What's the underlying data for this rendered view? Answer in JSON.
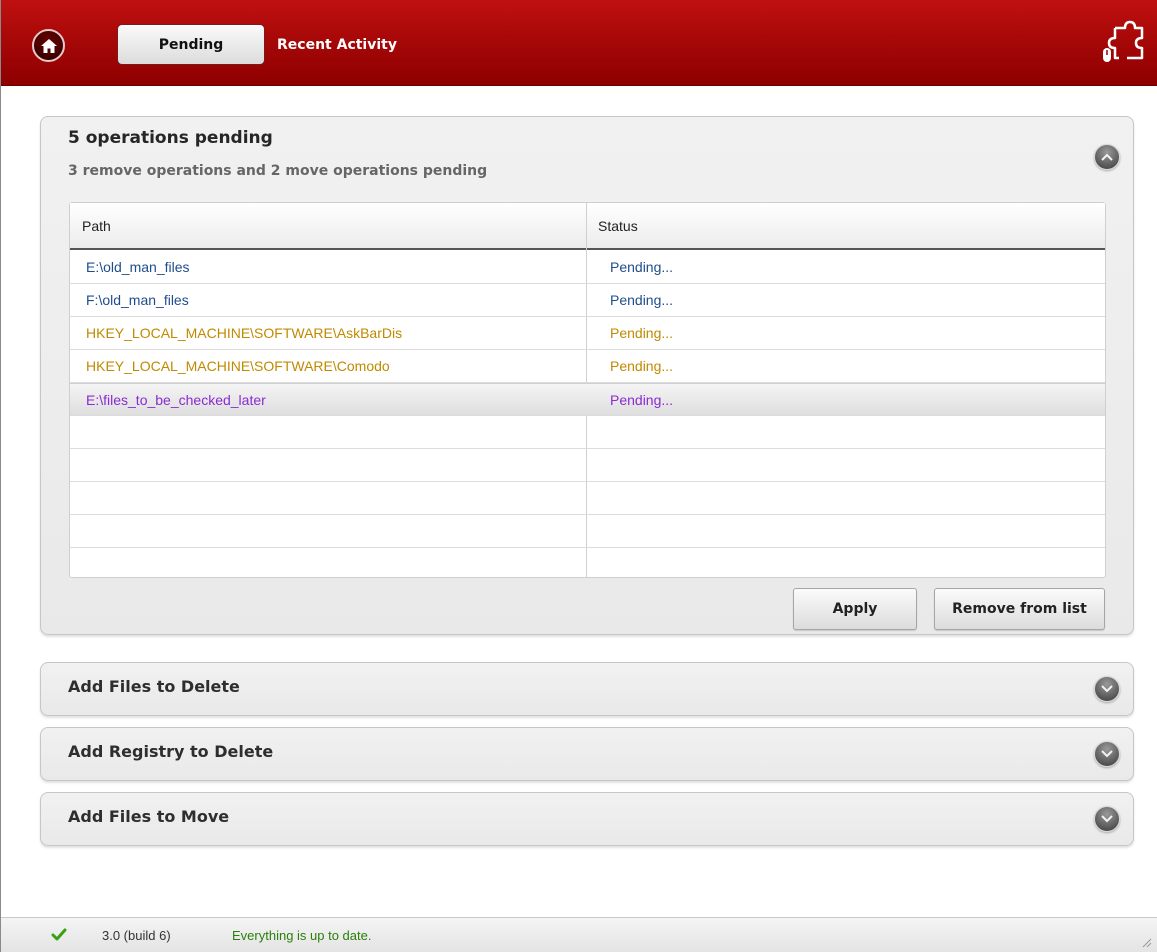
{
  "header": {
    "tabs": [
      {
        "label": "Pending",
        "active": true
      },
      {
        "label": "Recent Activity",
        "active": false
      }
    ],
    "icons": {
      "home": "home-icon",
      "logo": "puzzle-logo-icon"
    },
    "colors": {
      "bar": "#a80808",
      "active_tab_bg": "#eeeeee"
    }
  },
  "pending_panel": {
    "title": "5  operations pending",
    "subtitle": "3 remove operations and 2 move operations pending",
    "columns": {
      "path": "Path",
      "status": "Status"
    },
    "rows": [
      {
        "path": "E:\\old_man_files",
        "status": "Pending...",
        "color": "#1f4d8c"
      },
      {
        "path": "F:\\old_man_files",
        "status": "Pending...",
        "color": "#1f4d8c"
      },
      {
        "path": "HKEY_LOCAL_MACHINE\\SOFTWARE\\AskBarDis",
        "status": "Pending...",
        "color": "#c08a00"
      },
      {
        "path": "HKEY_LOCAL_MACHINE\\SOFTWARE\\Comodo",
        "status": "Pending...",
        "color": "#c08a00"
      },
      {
        "path": "E:\\files_to_be_checked_later",
        "status": "Pending...",
        "color": "#8a2bd2",
        "selected": true
      }
    ],
    "apply_label": "Apply",
    "remove_label": "Remove from list"
  },
  "sections": [
    {
      "label": "Add Files to Delete"
    },
    {
      "label": "Add Registry to Delete"
    },
    {
      "label": "Add Files to Move"
    }
  ],
  "statusbar": {
    "version": "3.0 (build 6)",
    "message": "Everything is up to date.",
    "message_color": "#2a7f0a"
  }
}
